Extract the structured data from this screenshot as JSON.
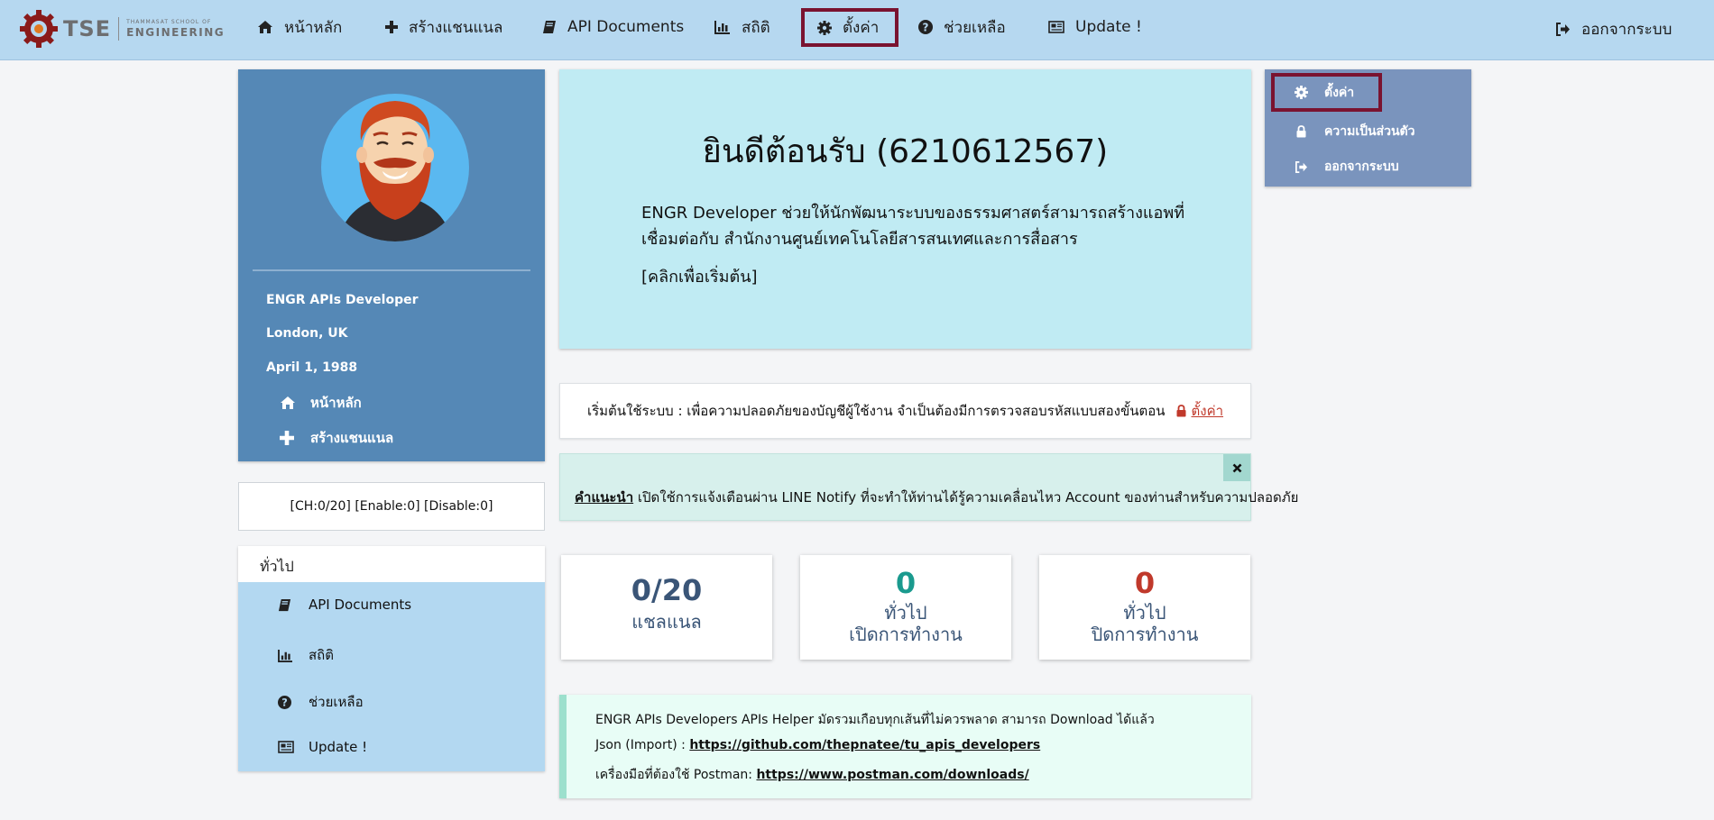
{
  "navbar": {
    "logo": {
      "tse": "TSE",
      "school_line": "THAMMASAT SCHOOL OF",
      "engineering": "ENGINEERING"
    },
    "items": [
      {
        "label": "หน้าหลัก",
        "icon": "home-icon"
      },
      {
        "label": "สร้างแชนแนล",
        "icon": "plus-icon"
      },
      {
        "label": "API Documents",
        "icon": "book-icon"
      },
      {
        "label": "สถิติ",
        "icon": "bar-chart-icon"
      },
      {
        "label": "ตั้งค่า",
        "icon": "gear-icon",
        "active": true
      },
      {
        "label": "ช่วยเหลือ",
        "icon": "question-circle-icon"
      },
      {
        "label": "Update !",
        "icon": "newspaper-icon"
      }
    ],
    "logout_label": "ออกจากระบบ"
  },
  "profile": {
    "name": "ENGR APIs Developer",
    "location": "London, UK",
    "date": "April 1, 1988",
    "links": [
      {
        "label": "หน้าหลัก",
        "icon": "home-icon"
      },
      {
        "label": "สร้างแชนแนล",
        "icon": "plus-icon"
      }
    ]
  },
  "counter": "[CH:0/20] [Enable:0] [Disable:0]",
  "general": {
    "heading": "ทั่วไป",
    "items": [
      {
        "label": "API Documents",
        "icon": "book-icon"
      },
      {
        "label": "สถิติ",
        "icon": "bar-chart-icon"
      },
      {
        "label": "ช่วยเหลือ",
        "icon": "question-circle-icon"
      },
      {
        "label": "Update !",
        "icon": "newspaper-icon"
      }
    ]
  },
  "welcome": {
    "title": "ยินดีต้อนรับ (6210612567)",
    "desc_line1": "ENGR Developer ช่วยให้นักพัฒนาระบบของธรรมศาสตร์สามารถสร้างแอพที่",
    "desc_line2": "เชื่อมต่อกับ สำนักงานศูนย์เทคโนโลยีสารสนเทศและการสื่อสาร",
    "start_link": "[คลิกเพื่อเริ่มต้น]"
  },
  "security": {
    "text": "เริ่มต้นใช้ระบบ : เพื่อความปลอดภัยของบัญชีผู้ใช้งาน จำเป็นต้องมีการตรวจสอบรหัสแบบสองขั้นตอน",
    "link": "ตั้งค่า"
  },
  "tip": {
    "label": "คำแนะนำ",
    "text": " เปิดใช้การแจ้งเตือนผ่าน LINE Notify ที่จะทำให้ท่านได้รู้ความเคลื่อนไหว Account ของท่านสำหรับความปลอดภัย"
  },
  "stats": [
    {
      "value": "0/20",
      "label1": "แชลแนล",
      "label2": "",
      "color": "#3a5577"
    },
    {
      "value": "0",
      "label1": "ทั่วไป",
      "label2": "เปิดการทำงาน",
      "color": "#1a9a8e"
    },
    {
      "value": "0",
      "label1": "ทั่วไป",
      "label2": "ปิดการทำงาน",
      "color": "#c0392b"
    }
  ],
  "info": {
    "line1": "ENGR APIs Developers APIs Helper มัดรวมเกือบทุกเส้นที่ไม่ควรพลาด สามารถ Download ได้แล้ว",
    "json_prefix": "Json (Import) : ",
    "json_link": "https://github.com/thepnatee/tu_apis_developers",
    "postman_prefix": "เครื่องมือที่ต้องใช้ Postman: ",
    "postman_link": "https://www.postman.com/downloads/"
  },
  "settings_menu": {
    "items": [
      {
        "label": "ตั้งค่า",
        "icon": "gear-icon",
        "active": true
      },
      {
        "label": "ความเป็นส่วนตัว",
        "icon": "lock-icon"
      },
      {
        "label": "ออกจากระบบ",
        "icon": "sign-out-icon"
      }
    ]
  },
  "colors": {
    "navbar": "#b6d8f0",
    "profile": "#5588b6",
    "welcome": "#c0ebf3",
    "active_border": "#7a1330",
    "settings_menu": "#7a94bd"
  }
}
